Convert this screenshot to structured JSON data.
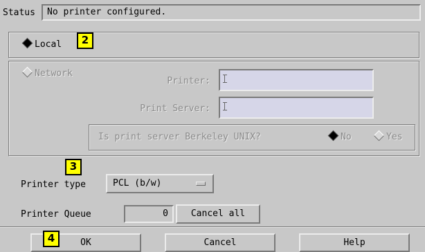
{
  "status": {
    "label": "Status",
    "value": "No printer configured."
  },
  "connection": {
    "local_label": "Local",
    "network_label": "Network",
    "printer_label": "Printer:",
    "print_server_label": "Print Server:",
    "printer_value": "",
    "print_server_value": "",
    "berkeley_question": "Is print server Berkeley UNIX?",
    "no_label": "No",
    "yes_label": "Yes"
  },
  "printer_type": {
    "label": "Printer type",
    "value": "PCL (b/w)"
  },
  "printer_queue": {
    "label": "Printer Queue",
    "count": "0",
    "cancel_all_label": "Cancel all"
  },
  "buttons": {
    "ok": "OK",
    "cancel": "Cancel",
    "help": "Help"
  },
  "annotations": {
    "tag2": "2",
    "tag3": "3",
    "tag4": "4"
  },
  "colors": {
    "background": "#c8c8c8",
    "annotation_fill": "#ffff00",
    "disabled_field": "#d6d6e8"
  },
  "radio_state": {
    "local": "selected",
    "network": "unselected",
    "no": "selected",
    "yes": "unselected"
  }
}
